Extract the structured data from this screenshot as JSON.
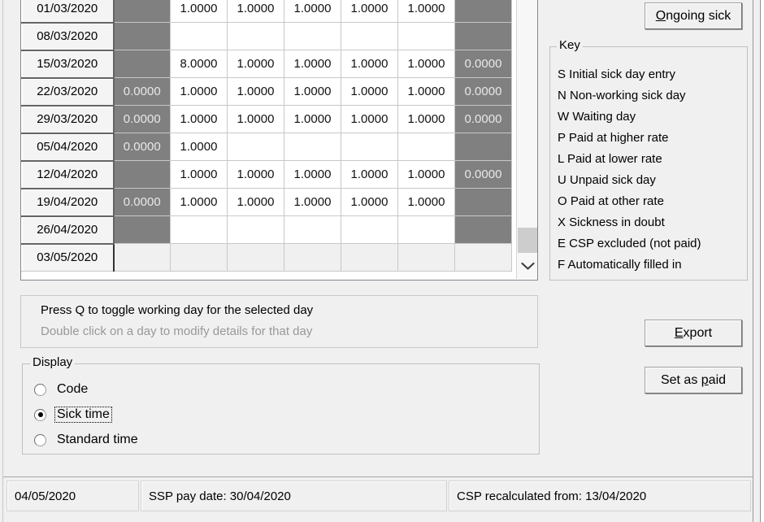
{
  "window": {
    "background_color": "#F0F0F0"
  },
  "colors": {
    "non_working_cell": "#808080",
    "working_cell": "#FFFFFF",
    "cell_text": "#111111",
    "off_cell_text": "#E8E8E8",
    "hint_text": "#989898",
    "groupbox_border": "#C0C0C0"
  },
  "grid": {
    "name": "sick-day-grid",
    "row_count_visible": 10,
    "column_count": 7,
    "rows": [
      {
        "date": "01/03/2020",
        "cells": [
          {
            "value": "",
            "state": "non-working"
          },
          {
            "value": "1.0000",
            "state": "working"
          },
          {
            "value": "1.0000",
            "state": "working"
          },
          {
            "value": "1.0000",
            "state": "working"
          },
          {
            "value": "1.0000",
            "state": "working"
          },
          {
            "value": "1.0000",
            "state": "working"
          },
          {
            "value": "",
            "state": "non-working"
          }
        ]
      },
      {
        "date": "08/03/2020",
        "cells": [
          {
            "value": "",
            "state": "non-working"
          },
          {
            "value": "",
            "state": "working"
          },
          {
            "value": "",
            "state": "working"
          },
          {
            "value": "",
            "state": "working"
          },
          {
            "value": "",
            "state": "working"
          },
          {
            "value": "",
            "state": "working"
          },
          {
            "value": "",
            "state": "non-working"
          }
        ]
      },
      {
        "date": "15/03/2020",
        "cells": [
          {
            "value": "",
            "state": "non-working"
          },
          {
            "value": "8.0000",
            "state": "working"
          },
          {
            "value": "1.0000",
            "state": "working"
          },
          {
            "value": "1.0000",
            "state": "working"
          },
          {
            "value": "1.0000",
            "state": "working"
          },
          {
            "value": "1.0000",
            "state": "working"
          },
          {
            "value": "0.0000",
            "state": "non-working"
          }
        ]
      },
      {
        "date": "22/03/2020",
        "cells": [
          {
            "value": "0.0000",
            "state": "non-working"
          },
          {
            "value": "1.0000",
            "state": "working"
          },
          {
            "value": "1.0000",
            "state": "working"
          },
          {
            "value": "1.0000",
            "state": "working"
          },
          {
            "value": "1.0000",
            "state": "working"
          },
          {
            "value": "1.0000",
            "state": "working"
          },
          {
            "value": "0.0000",
            "state": "non-working"
          }
        ]
      },
      {
        "date": "29/03/2020",
        "cells": [
          {
            "value": "0.0000",
            "state": "non-working"
          },
          {
            "value": "1.0000",
            "state": "working"
          },
          {
            "value": "1.0000",
            "state": "working"
          },
          {
            "value": "1.0000",
            "state": "working"
          },
          {
            "value": "1.0000",
            "state": "working"
          },
          {
            "value": "1.0000",
            "state": "working"
          },
          {
            "value": "0.0000",
            "state": "non-working"
          }
        ]
      },
      {
        "date": "05/04/2020",
        "cells": [
          {
            "value": "0.0000",
            "state": "non-working"
          },
          {
            "value": "1.0000",
            "state": "working"
          },
          {
            "value": "",
            "state": "working"
          },
          {
            "value": "",
            "state": "working"
          },
          {
            "value": "",
            "state": "working"
          },
          {
            "value": "",
            "state": "working"
          },
          {
            "value": "",
            "state": "non-working"
          }
        ]
      },
      {
        "date": "12/04/2020",
        "cells": [
          {
            "value": "",
            "state": "non-working"
          },
          {
            "value": "1.0000",
            "state": "working"
          },
          {
            "value": "1.0000",
            "state": "working"
          },
          {
            "value": "1.0000",
            "state": "working"
          },
          {
            "value": "1.0000",
            "state": "working"
          },
          {
            "value": "1.0000",
            "state": "working"
          },
          {
            "value": "0.0000",
            "state": "non-working"
          }
        ]
      },
      {
        "date": "19/04/2020",
        "cells": [
          {
            "value": "0.0000",
            "state": "non-working"
          },
          {
            "value": "1.0000",
            "state": "working"
          },
          {
            "value": "1.0000",
            "state": "working"
          },
          {
            "value": "1.0000",
            "state": "working"
          },
          {
            "value": "1.0000",
            "state": "working"
          },
          {
            "value": "1.0000",
            "state": "working"
          },
          {
            "value": "",
            "state": "non-working"
          }
        ]
      },
      {
        "date": "26/04/2020",
        "cells": [
          {
            "value": "",
            "state": "non-working"
          },
          {
            "value": "",
            "state": "working"
          },
          {
            "value": "",
            "state": "working"
          },
          {
            "value": "",
            "state": "working"
          },
          {
            "value": "",
            "state": "working"
          },
          {
            "value": "",
            "state": "working"
          },
          {
            "value": "",
            "state": "non-working"
          }
        ]
      },
      {
        "date": "03/05/2020",
        "cells": [
          {
            "value": "",
            "state": "inactive"
          },
          {
            "value": "",
            "state": "inactive"
          },
          {
            "value": "",
            "state": "inactive"
          },
          {
            "value": "",
            "state": "inactive"
          },
          {
            "value": "",
            "state": "inactive"
          },
          {
            "value": "",
            "state": "inactive"
          },
          {
            "value": "",
            "state": "inactive"
          }
        ]
      }
    ],
    "scrollbar": {
      "down_arrow_icon": "chevron-down-icon"
    }
  },
  "buttons": {
    "ongoing_sick": {
      "label": "Ongoing sick",
      "accelerator": "O"
    },
    "export": {
      "label": "Export",
      "accelerator": "E"
    },
    "set_as_paid": {
      "label": "Set as paid",
      "accelerator": "p"
    }
  },
  "key_group": {
    "legend": "Key",
    "items": [
      "S Initial sick day entry",
      "N Non-working sick day",
      "W Waiting day",
      "P Paid at higher rate",
      "L Paid at lower rate",
      "U Unpaid sick day",
      "O Paid at other rate",
      "X Sickness in doubt",
      "E CSP excluded (not paid)",
      "F Automatically filled in"
    ]
  },
  "instructions": {
    "line1": "Press Q to toggle working day for the selected day",
    "line2": "Double click on a day to modify details for that day"
  },
  "display_group": {
    "legend": "Display",
    "options": [
      {
        "label": "Code",
        "selected": false,
        "focused": false
      },
      {
        "label": "Sick time",
        "selected": true,
        "focused": true
      },
      {
        "label": "Standard time",
        "selected": false,
        "focused": false
      }
    ]
  },
  "statusbar": {
    "panels": [
      "04/05/2020",
      "SSP pay date: 30/04/2020",
      "CSP recalculated from: 13/04/2020"
    ]
  }
}
